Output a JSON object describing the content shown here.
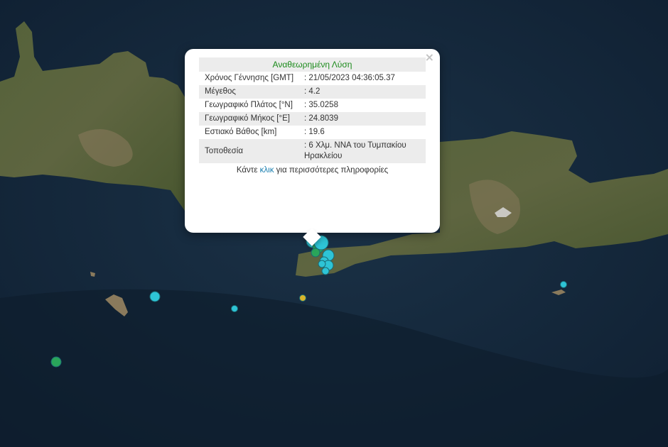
{
  "popup": {
    "close_symbol": "×",
    "title": "Αναθεωρημένη Λύση",
    "rows": [
      {
        "label": "Χρόνος Γέννησης [GMT]",
        "value": ": 21/05/2023 04:36:05.37"
      },
      {
        "label": "Μέγεθος",
        "value": ": 4.2"
      },
      {
        "label": "Γεωγραφικό Πλάτος [°N]",
        "value": ": 35.0258"
      },
      {
        "label": "Γεωγραφικό Μήκος [°E]",
        "value": ": 24.8039"
      },
      {
        "label": "Εστιακό Βάθος [km]",
        "value": ": 19.6"
      },
      {
        "label": "Τοποθεσία",
        "value": ": 6 Χλμ. ΝΝΑ του Τυμπακίου Ηρακλείου"
      }
    ],
    "more_prefix": "Κάντε ",
    "more_link": "κλικ",
    "more_suffix": " για περισσότερες πληροφορίες"
  },
  "colors": {
    "sea": "#14283c",
    "land": "#4c5a34",
    "marker_cyan": "#2ec4d6",
    "marker_green": "#2aa55a",
    "marker_yellow": "#d8b42a",
    "title_green": "#1a8a1a",
    "link_blue": "#1a7fb0"
  },
  "markers": {
    "cyan": 14,
    "green": 3,
    "yellow": 1
  }
}
